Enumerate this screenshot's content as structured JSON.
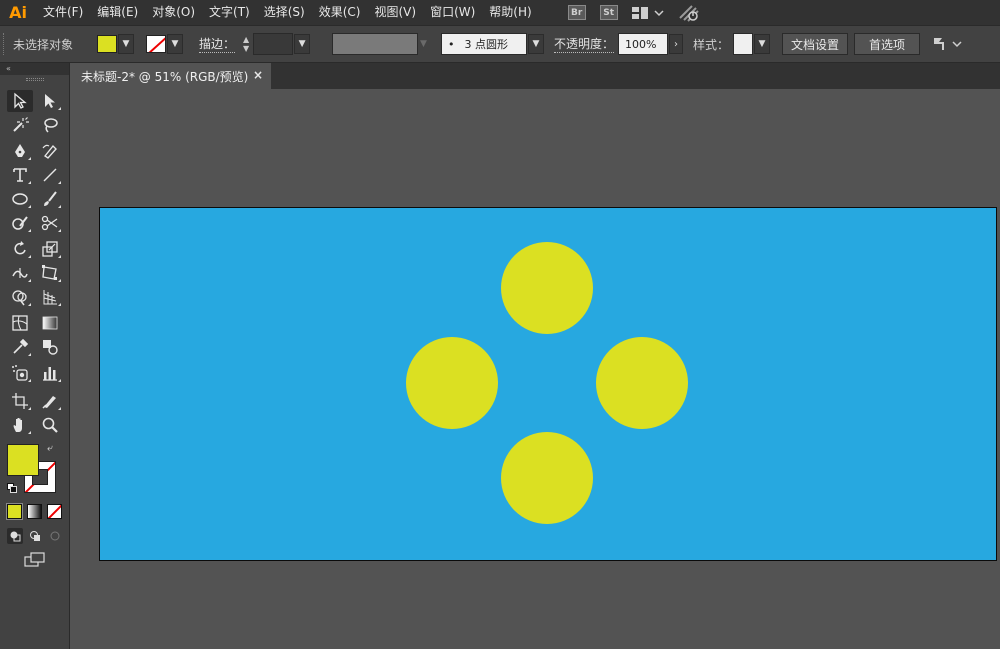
{
  "app": {
    "logo": "Ai"
  },
  "menu": {
    "items": [
      "文件(F)",
      "编辑(E)",
      "对象(O)",
      "文字(T)",
      "选择(S)",
      "效果(C)",
      "视图(V)",
      "窗口(W)",
      "帮助(H)"
    ],
    "br_badge": "Br",
    "st_badge": "St"
  },
  "control_bar": {
    "no_selection": "未选择对象",
    "stroke_label": "描边：",
    "brush_value": "3 点圆形",
    "brush_dot": "•",
    "opacity_label": "不透明度：",
    "opacity_value": "100%",
    "style_label": "样式：",
    "doc_setup_button": "文档设置",
    "preferences_button": "首选项"
  },
  "left_panel": {
    "collapse_glyph": "«"
  },
  "document": {
    "tab_title": "未标题-2* @ 51% (RGB/预览)",
    "tab_close": "×"
  },
  "colors": {
    "fill": "#dbe022",
    "artboard": "#27a8e0",
    "stroke": "none",
    "app_accent": "#ff9a00"
  },
  "artboard": {
    "shapes": [
      {
        "type": "circle",
        "name": "top"
      },
      {
        "type": "circle",
        "name": "left"
      },
      {
        "type": "circle",
        "name": "right"
      },
      {
        "type": "circle",
        "name": "bottom"
      }
    ]
  },
  "icons": {
    "menubar": [
      "bridge-icon",
      "stock-icon",
      "workspace-switcher-icon",
      "gpu-performance-icon"
    ],
    "tools": [
      "selection-tool-icon",
      "direct-selection-tool-icon",
      "magic-wand-icon",
      "lasso-icon",
      "pen-tool-icon",
      "curvature-tool-icon",
      "type-tool-icon",
      "line-segment-icon",
      "ellipse-tool-icon",
      "paintbrush-icon",
      "shaper-tool-icon",
      "scissors-icon",
      "rotate-tool-icon",
      "scale-tool-icon",
      "width-tool-icon",
      "free-transform-icon",
      "shape-builder-icon",
      "perspective-grid-icon",
      "mesh-tool-icon",
      "gradient-tool-icon",
      "eyedropper-icon",
      "blend-tool-icon",
      "symbol-sprayer-icon",
      "column-graph-icon",
      "artboard-tool-icon",
      "slice-tool-icon",
      "hand-tool-icon",
      "zoom-tool-icon"
    ]
  }
}
